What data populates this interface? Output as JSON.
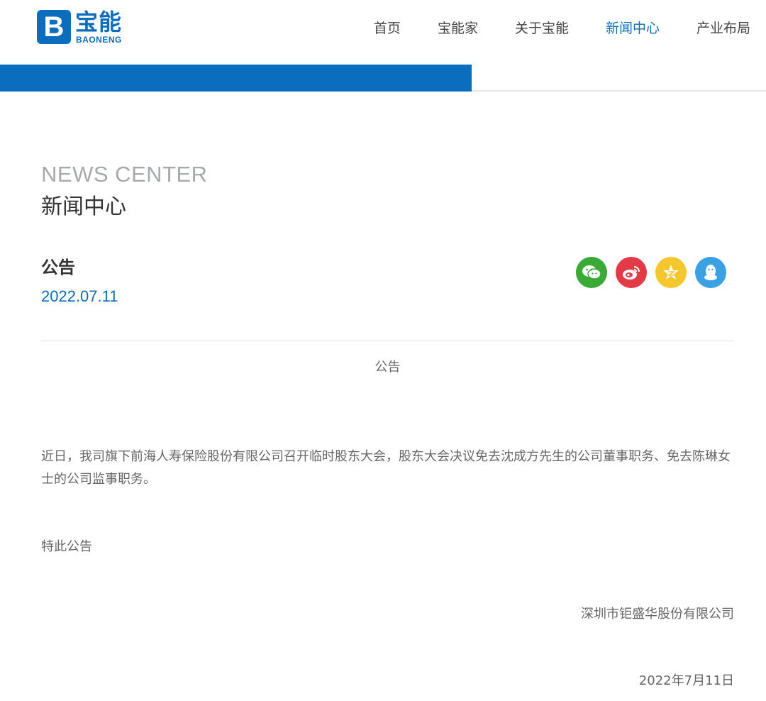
{
  "brand": {
    "mark": "B",
    "name_cn": "宝能",
    "name_en": "BAONENG",
    "color": "#0b6dbd"
  },
  "nav": {
    "items": [
      {
        "label": "首页"
      },
      {
        "label": "宝能家"
      },
      {
        "label": "关于宝能"
      },
      {
        "label": "新闻中心",
        "active": true
      },
      {
        "label": "产业布局"
      }
    ]
  },
  "section": {
    "title_en": "NEWS CENTER",
    "title_cn": "新闻中心"
  },
  "article": {
    "title": "公告",
    "date": "2022.07.11",
    "heading": "公告",
    "body": "近日，我司旗下前海人寿保险股份有限公司召开临时股东大会，股东大会决议免去沈成方先生的公司董事职务、免去陈琳女士的公司监事职务。",
    "closing": "特此公告",
    "signature": "深圳市钜盛华股份有限公司",
    "sign_date": "2022年7月11日"
  },
  "share": {
    "buttons": [
      {
        "icon": "wechat-icon",
        "color": "#3aa935"
      },
      {
        "icon": "weibo-icon",
        "color": "#e23a46"
      },
      {
        "icon": "qzone-icon",
        "color": "#f3c72d"
      },
      {
        "icon": "qq-icon",
        "color": "#3ba1e3"
      }
    ]
  }
}
